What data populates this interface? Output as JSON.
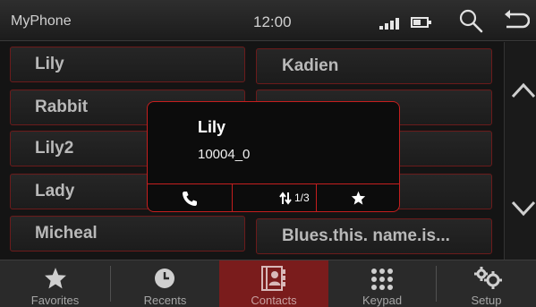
{
  "header": {
    "app_title": "MyPhone",
    "time": "12:00",
    "battery_level": 0.6
  },
  "contacts": {
    "left": [
      "Lily",
      "Rabbit",
      "Lily2",
      "Lady",
      "Micheal"
    ],
    "right": [
      "Kadien",
      "",
      "",
      "",
      "Blues.this. name.is..."
    ]
  },
  "popup": {
    "name": "Lily",
    "number": "10004_0",
    "number_index": "1/3",
    "actions": [
      "phone-icon",
      "switch-number-icon",
      "star-icon"
    ]
  },
  "tabs": [
    {
      "label": "Favorites",
      "icon": "star-icon",
      "active": false
    },
    {
      "label": "Recents",
      "icon": "clock-icon",
      "active": false
    },
    {
      "label": "Contacts",
      "icon": "contacts-book-icon",
      "active": true
    },
    {
      "label": "Keypad",
      "icon": "keypad-icon",
      "active": false
    },
    {
      "label": "Setup",
      "icon": "gears-icon",
      "active": false
    }
  ],
  "colors": {
    "accent_red": "#c41e1e",
    "active_tab": "#7a1c1c",
    "background": "#141414"
  }
}
